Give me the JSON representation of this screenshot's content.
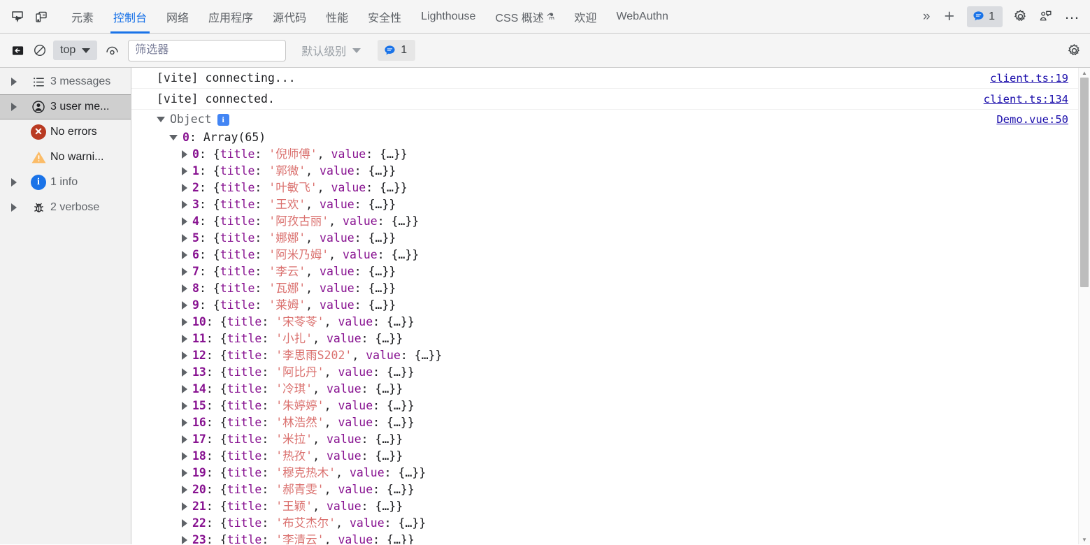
{
  "devtools": {
    "left_icons": [
      {
        "name": "inspect-element-icon",
        "label": "Inspect element"
      },
      {
        "name": "device-toolbar-icon",
        "label": "Toggle device toolbar"
      }
    ],
    "tabs": [
      {
        "label": "元素",
        "active": false
      },
      {
        "label": "控制台",
        "active": true
      },
      {
        "label": "网络",
        "active": false
      },
      {
        "label": "应用程序",
        "active": false
      },
      {
        "label": "源代码",
        "active": false
      },
      {
        "label": "性能",
        "active": false
      },
      {
        "label": "安全性",
        "active": false
      },
      {
        "label": "Lighthouse",
        "active": false
      },
      {
        "label": "CSS 概述",
        "active": false,
        "flask": "⚗"
      },
      {
        "label": "欢迎",
        "active": false
      },
      {
        "label": "WebAuthn",
        "active": false
      }
    ],
    "more_tabs_icon": "»",
    "add_tab_icon": "+",
    "message_badge_count": "1",
    "settings_icon": "gear-icon",
    "feedback_icon": "feedback-icon",
    "more_options_icon": "…"
  },
  "console_toolbar": {
    "clear_console_icon": "clear-console-icon",
    "no_entry_icon": "no-entry-icon",
    "context_selector": {
      "label": "top"
    },
    "eye_icon": "live-expression-icon",
    "filter": {
      "placeholder": "筛选器",
      "value": ""
    },
    "level_selector": {
      "label": "默认级别"
    },
    "issues_count": "1",
    "settings_icon": "console-settings-icon"
  },
  "sidebar": {
    "items": [
      {
        "label": "3 messages",
        "icon": "list-icon",
        "arrow": true,
        "selected": false,
        "dark": false
      },
      {
        "label": "3 user me...",
        "icon": "user-icon",
        "arrow": true,
        "selected": true,
        "dark": true
      },
      {
        "label": "No errors",
        "icon": "error-icon",
        "arrow": false,
        "selected": false,
        "dark": true
      },
      {
        "label": "No warni...",
        "icon": "warning-icon",
        "arrow": false,
        "selected": false,
        "dark": true
      },
      {
        "label": "1 info",
        "icon": "info-icon",
        "arrow": true,
        "selected": false,
        "dark": false
      },
      {
        "label": "2 verbose",
        "icon": "bug-icon",
        "arrow": true,
        "selected": false,
        "dark": false
      }
    ]
  },
  "console": {
    "messages": [
      {
        "text": "[vite] connecting...",
        "source": "client.ts:19"
      },
      {
        "text": "[vite] connected.",
        "source": "client.ts:134"
      }
    ],
    "object_log": {
      "root_label": "Object",
      "root_info_icon": "i",
      "source": "Demo.vue:50",
      "array_key": "0",
      "array_label": "Array(65)",
      "entries": [
        {
          "index": "0",
          "title": "倪师傅"
        },
        {
          "index": "1",
          "title": "郭微"
        },
        {
          "index": "2",
          "title": "叶敏飞"
        },
        {
          "index": "3",
          "title": "王欢"
        },
        {
          "index": "4",
          "title": "阿孜古丽"
        },
        {
          "index": "5",
          "title": "娜娜"
        },
        {
          "index": "6",
          "title": "阿米乃姆"
        },
        {
          "index": "7",
          "title": "李云"
        },
        {
          "index": "8",
          "title": "瓦娜"
        },
        {
          "index": "9",
          "title": "莱姆"
        },
        {
          "index": "10",
          "title": "宋苓苓"
        },
        {
          "index": "11",
          "title": "小扎"
        },
        {
          "index": "12",
          "title": "李思雨S202"
        },
        {
          "index": "13",
          "title": "阿比丹"
        },
        {
          "index": "14",
          "title": "冷琪"
        },
        {
          "index": "15",
          "title": "朱婷婷"
        },
        {
          "index": "16",
          "title": "林浩然"
        },
        {
          "index": "17",
          "title": "米拉"
        },
        {
          "index": "18",
          "title": "热孜"
        },
        {
          "index": "19",
          "title": "穆克热木"
        },
        {
          "index": "20",
          "title": "郝青雯"
        },
        {
          "index": "21",
          "title": "王颖"
        },
        {
          "index": "22",
          "title": "布艾杰尔"
        },
        {
          "index": "23",
          "title": "李清云"
        }
      ],
      "prop_key": "title",
      "value_key": "value",
      "value_collapsed": "{…}"
    }
  },
  "colors": {
    "accent_blue": "#1a73e8",
    "link_blue": "#1a0dab",
    "error_red": "#b93a22",
    "warning_orange": "#fbbc68",
    "info_blue": "#1a73e8",
    "string_purple": "#c41a16",
    "key_magenta": "#881391",
    "toolbar_bg": "#f5f5f5",
    "sidebar_bg": "#f2f2f2"
  }
}
